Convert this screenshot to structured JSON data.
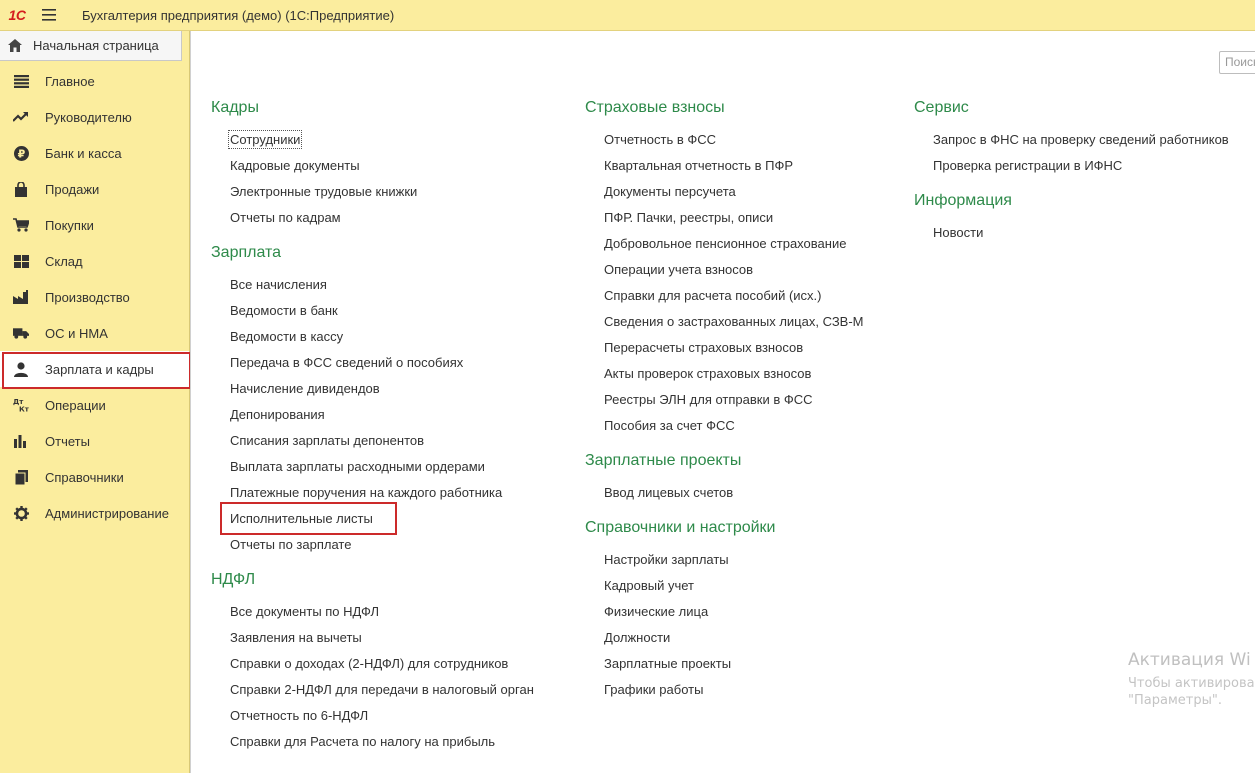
{
  "app": {
    "logo": "1С",
    "title": "Бухгалтерия предприятия (демо)  (1С:Предприятие)"
  },
  "home_tab": {
    "label": "Начальная страница"
  },
  "sidebar": {
    "items": [
      {
        "label": "Главное",
        "icon": "list-icon"
      },
      {
        "label": "Руководителю",
        "icon": "trend-icon"
      },
      {
        "label": "Банк и касса",
        "icon": "ruble-icon"
      },
      {
        "label": "Продажи",
        "icon": "shopping-bag-icon"
      },
      {
        "label": "Покупки",
        "icon": "cart-icon"
      },
      {
        "label": "Склад",
        "icon": "grid-icon"
      },
      {
        "label": "Производство",
        "icon": "factory-icon"
      },
      {
        "label": "ОС и НМА",
        "icon": "truck-icon"
      },
      {
        "label": "Зарплата и кадры",
        "icon": "person-icon",
        "active": true
      },
      {
        "label": "Операции",
        "icon": "dt-kt-icon"
      },
      {
        "label": "Отчеты",
        "icon": "bar-chart-icon"
      },
      {
        "label": "Справочники",
        "icon": "book-icon"
      },
      {
        "label": "Администрирование",
        "icon": "gear-icon"
      }
    ],
    "dt_kt_glyph": "Дт Кт"
  },
  "search": {
    "placeholder": "Поиск"
  },
  "sections": {
    "kadry": {
      "title": "Кадры",
      "links": [
        "Сотрудники",
        "Кадровые документы",
        "Электронные трудовые книжки",
        "Отчеты по кадрам"
      ]
    },
    "zarplata": {
      "title": "Зарплата",
      "links": [
        "Все начисления",
        "Ведомости в банк",
        "Ведомости в кассу",
        "Передача в ФСС сведений о пособиях",
        "Начисление дивидендов",
        "Депонирования",
        "Списания зарплаты депонентов",
        "Выплата зарплаты расходными ордерами",
        "Платежные поручения на каждого работника",
        "Исполнительные листы",
        "Отчеты по зарплате"
      ]
    },
    "ndfl": {
      "title": "НДФЛ",
      "links": [
        "Все документы по НДФЛ",
        "Заявления на вычеты",
        "Справки о доходах (2-НДФЛ) для сотрудников",
        "Справки 2-НДФЛ для передачи в налоговый орган",
        "Отчетность по 6-НДФЛ",
        "Справки для Расчета по налогу на прибыль"
      ]
    },
    "strah": {
      "title": "Страховые взносы",
      "links": [
        "Отчетность в ФСС",
        "Квартальная отчетность в ПФР",
        "Документы персучета",
        "ПФР. Пачки, реестры, описи",
        "Добровольное пенсионное страхование",
        "Операции учета взносов",
        "Справки для расчета пособий (исх.)",
        "Сведения о застрахованных лицах, СЗВ-М",
        "Перерасчеты страховых взносов",
        "Акты проверок страховых взносов",
        "Реестры ЭЛН для отправки в ФСС",
        "Пособия за счет ФСС"
      ]
    },
    "proekty": {
      "title": "Зарплатные проекты",
      "links": [
        "Ввод лицевых счетов"
      ]
    },
    "spravochniki": {
      "title": "Справочники и настройки",
      "links": [
        "Настройки зарплаты",
        "Кадровый учет",
        "Физические лица",
        "Должности",
        "Зарплатные проекты",
        "Графики работы"
      ]
    },
    "servis": {
      "title": "Сервис",
      "links": [
        "Запрос в ФНС на проверку сведений работников",
        "Проверка регистрации в ИФНС"
      ]
    },
    "info": {
      "title": "Информация",
      "links": [
        "Новости"
      ]
    }
  },
  "watermark": {
    "line1": "Активация Wi",
    "line2": "Чтобы активирова",
    "line3": "\"Параметры\"."
  },
  "colors": {
    "panel_bg": "#fbed9e",
    "section_title": "#2e8a4a",
    "highlight": "#cc2a2a"
  }
}
